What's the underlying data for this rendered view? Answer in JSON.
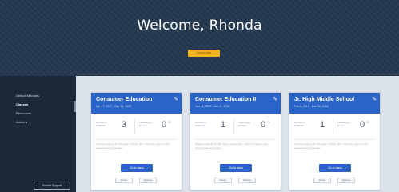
{
  "hero": {
    "title": "Welcome, Rhonda",
    "button_label": "Check roles"
  },
  "sidebar": {
    "items": [
      {
        "label": "Default Modules",
        "active": false
      },
      {
        "label": "Classes",
        "active": true
      },
      {
        "label": "Resources",
        "active": false
      },
      {
        "label": "Admin ▾",
        "active": false
      }
    ],
    "footer_button": "Submit Support"
  },
  "cards": [
    {
      "title": "Consumer Education",
      "dates": "Apr 17, 2017 - Sep 15, 2025",
      "stat1_label": "Number of Students",
      "stat1_value": "3",
      "stat2_label": "Percentage Graded",
      "stat2_value": "0",
      "stat2_unit": "%",
      "note": "Student progress for this class is shown here. Open the class to view assignments and grades.",
      "primary_button": "Go to class",
      "link1": "Roster",
      "link2": "Settings"
    },
    {
      "title": "Consumer Education II",
      "dates": "Jan 12, 2017 - Jun 11, 2018",
      "stat1_label": "Number of Students",
      "stat1_value": "1",
      "stat2_label": "Percentage Graded",
      "stat2_value": "0",
      "stat2_unit": "%",
      "note": "Student progress for this class is shown here. Open the class to view assignments and grades.",
      "primary_button": "Go to class",
      "link1": "Roster",
      "link2": "Settings"
    },
    {
      "title": "Jr. High Middle School",
      "dates": "Feb 6, 2017 - Mar 30, 2018",
      "stat1_label": "Number of Students",
      "stat1_value": "1",
      "stat2_label": "Percentage Graded",
      "stat2_value": "0",
      "stat2_unit": "%",
      "note": "Student progress for this class is shown here. Open the class to view assignments and grades.",
      "primary_button": "Go to class",
      "link1": "Roster",
      "link2": "Settings"
    }
  ],
  "colors": {
    "hero_bg": "#24384f",
    "accent_yellow": "#f1b41c",
    "card_blue": "#2b64c8",
    "sidebar_bg": "#1b2839"
  }
}
